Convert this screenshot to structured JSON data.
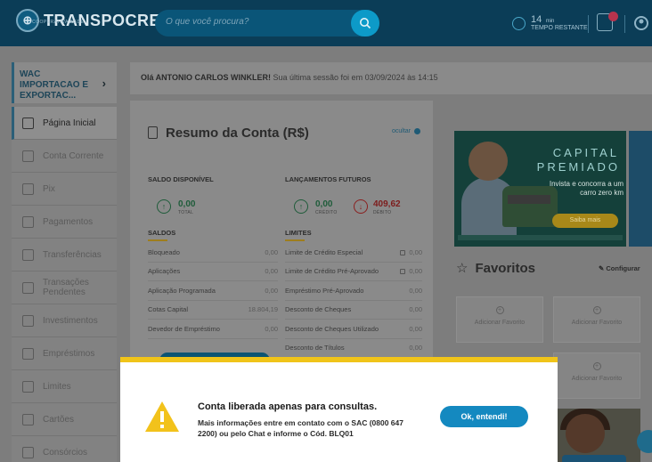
{
  "header": {
    "logo_text": "TRANSPOCRED",
    "logo_sub": "COOPERATIVA AGDE",
    "search_placeholder": "O que você procura?",
    "timer_value": "14",
    "timer_unit": "min",
    "timer_label": "TEMPO RESTANTE"
  },
  "company": {
    "name": "WAC IMPORTACAO E EXPORTAC..."
  },
  "welcome": {
    "name": "Olá ANTONIO CARLOS WINKLER!",
    "message": "Sua última sessão foi em 03/09/2024 às 14:15"
  },
  "sidebar": {
    "items": [
      {
        "label": "Página Inicial",
        "icon": "home-icon",
        "active": true
      },
      {
        "label": "Conta Corrente",
        "icon": "wallet-icon"
      },
      {
        "label": "Pix",
        "icon": "pix-icon"
      },
      {
        "label": "Pagamentos",
        "icon": "barcode-icon"
      },
      {
        "label": "Transferências",
        "icon": "transfer-icon"
      },
      {
        "label": "Transações Pendentes",
        "icon": "warning-icon"
      },
      {
        "label": "Investimentos",
        "icon": "chart-icon"
      },
      {
        "label": "Empréstimos",
        "icon": "loan-icon"
      },
      {
        "label": "Limites",
        "icon": "gauge-icon"
      },
      {
        "label": "Cartões",
        "icon": "card-icon"
      },
      {
        "label": "Consórcios",
        "icon": "people-icon"
      }
    ]
  },
  "summary": {
    "title": "Resumo da Conta (R$)",
    "hide_label": "ocultar",
    "available_label": "SALDO DISPONÍVEL",
    "available_value": "0,00",
    "available_sub": "TOTAL",
    "future_label": "LANÇAMENTOS FUTUROS",
    "credit_value": "0,00",
    "credit_sub": "CRÉDITO",
    "debit_value": "409,62",
    "debit_sub": "DÉBITO",
    "balances_label": "SALDOS",
    "limits_label": "LIMITES",
    "balances": [
      {
        "label": "Bloqueado",
        "value": "0,00"
      },
      {
        "label": "Aplicações",
        "value": "0,00"
      },
      {
        "label": "Aplicação Programada",
        "value": "0,00"
      },
      {
        "label": "Cotas Capital",
        "value": "18.804,19"
      },
      {
        "label": "Devedor de Empréstimo",
        "value": "0,00"
      }
    ],
    "limits": [
      {
        "label": "Limite de Crédito Especial",
        "value": "0,00",
        "locked": true
      },
      {
        "label": "Limite de Crédito Pré-Aprovado",
        "value": "0,00",
        "locked": true
      },
      {
        "label": "Empréstimo Pré-Aprovado",
        "value": "0,00"
      },
      {
        "label": "Desconto de Cheques",
        "value": "0,00"
      },
      {
        "label": "Desconto de Cheques Utilizado",
        "value": "0,00"
      },
      {
        "label": "Desconto de Títulos",
        "value": "0,00"
      }
    ]
  },
  "banner": {
    "title_line1": "CAPITAL",
    "title_line2": "PREMIADO",
    "description": "Invista e concorra a um carro zero km",
    "button": "Saiba mais"
  },
  "favorites": {
    "title": "Favoritos",
    "configure": "Configurar",
    "tile_label": "Adicionar Favorito"
  },
  "modal": {
    "title": "Conta liberada apenas para consultas.",
    "text": "Mais informações entre em contato com o SAC (0800 647 2200) ou pelo Chat e informe o Cód. BLQ01",
    "button": "Ok, entendi!"
  }
}
